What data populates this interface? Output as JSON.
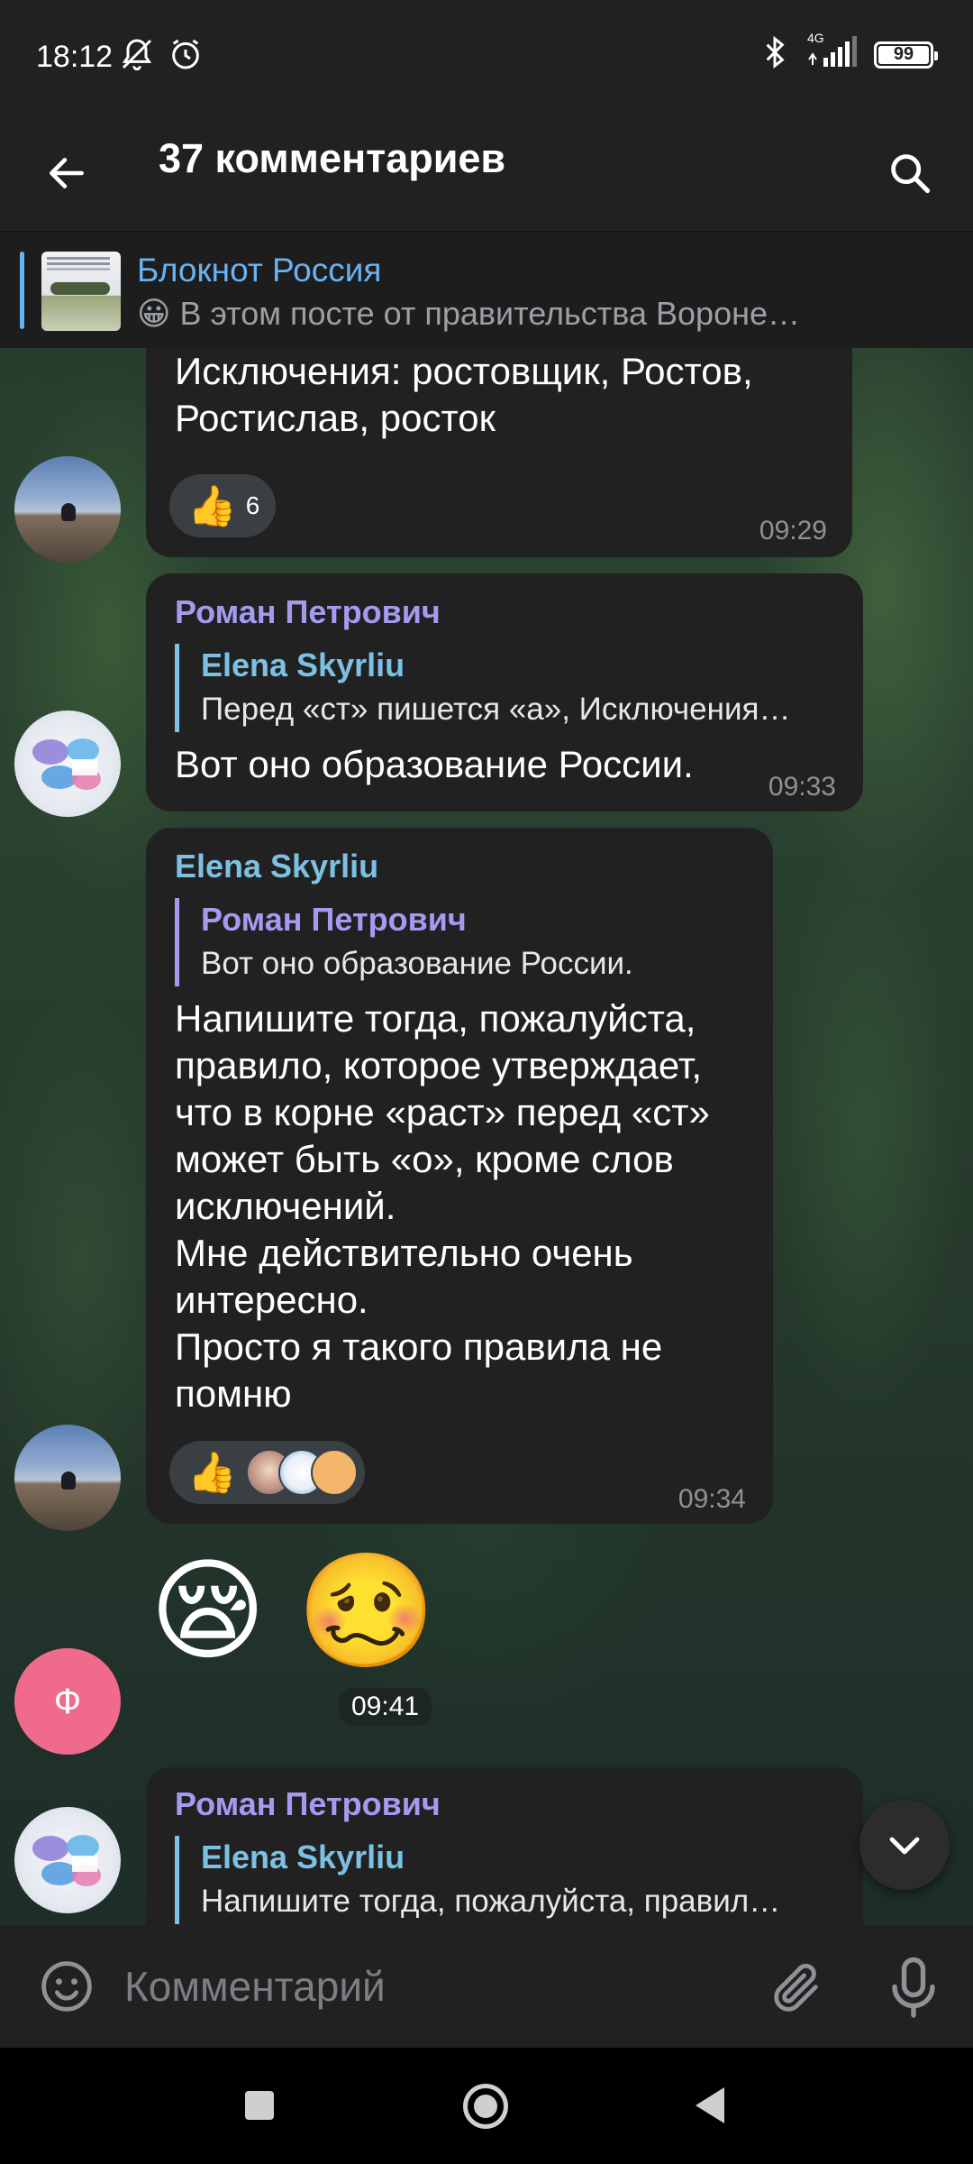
{
  "status_bar": {
    "time": "18:12",
    "network": "4G",
    "battery": "99"
  },
  "header": {
    "title": "37 комментариев"
  },
  "pinned": {
    "channel": "Блокнот Россия",
    "emoji": "😀",
    "text": "В этом посте от правительства Вороне…"
  },
  "messages": [
    {
      "text": "Исключения: ростовщик, Ростов,\nРостислав, росток",
      "reaction": {
        "emoji": "👍",
        "count": "6"
      },
      "time": "09:29"
    },
    {
      "sender": "Роман Петрович",
      "reply_name": "Elena Skyrliu",
      "reply_text": "Перед «ст» пишется «а», Исключения…",
      "text": "Вот оно образование России.",
      "time": "09:33"
    },
    {
      "sender": "Elena Skyrliu",
      "reply_name": "Роман Петрович",
      "reply_text": "Вот оно образование России.",
      "text": "Напишите тогда, пожалуйста,\nправило, которое утверждает,\nчто в корне «раст» перед «ст»\nможет быть «о», кроме слов\nисключений.\nМне действительно очень\nинтересно.\nПросто я такого правила не\nпомню",
      "reaction": {
        "emoji": "👍"
      },
      "time": "09:34"
    },
    {
      "avatar_letter": "Ф",
      "emojis": "😪 🥴",
      "time": "09:41"
    },
    {
      "sender": "Роман Петрович",
      "reply_name": "Elena Skyrliu",
      "reply_text": "Напишите тогда, пожалуйста, правил…"
    }
  ],
  "input": {
    "placeholder": "Комментарий"
  },
  "colors": {
    "link_blue": "#6ab3f3",
    "sender_purple": "#a49bf0",
    "sender_blue": "#7cc1e4",
    "bubble": "#212121",
    "avatar_f": "#f06a8e"
  }
}
